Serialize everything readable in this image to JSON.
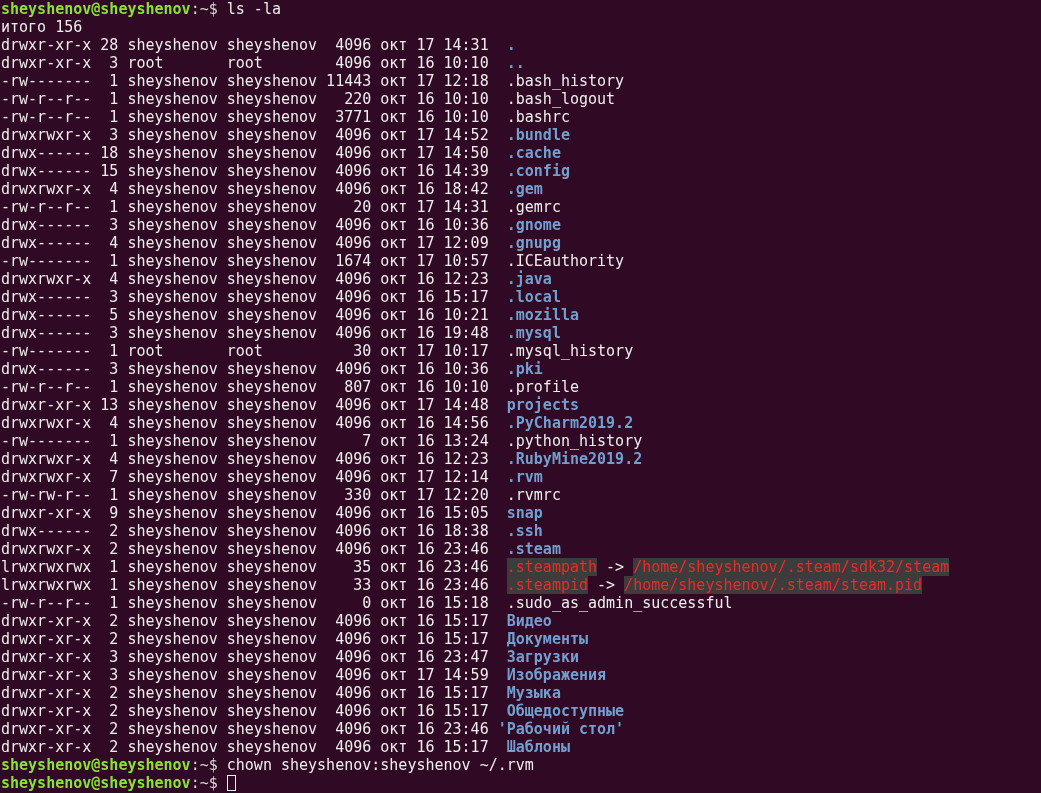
{
  "prompts": [
    {
      "user": "sheyshenov@sheyshenov",
      "path": ":~$",
      "command": "ls -la"
    },
    {
      "user": "sheyshenov@sheyshenov",
      "path": ":~$",
      "command": "chown sheyshenov:sheyshenov ~/.rvm"
    },
    {
      "user": "sheyshenov@sheyshenov",
      "path": ":~$",
      "cursor": true
    }
  ],
  "total": "итого 156",
  "entries": [
    {
      "meta": "drwxr-xr-x 28 sheyshenov sheyshenov  4096 окт 17 14:31  ",
      "name": ".",
      "kind": "dir"
    },
    {
      "meta": "drwxr-xr-x  3 root       root        4096 окт 16 10:10  ",
      "name": "..",
      "kind": "dir"
    },
    {
      "meta": "-rw-------  1 sheyshenov sheyshenov 11443 окт 17 12:18  ",
      "name": ".bash_history",
      "kind": "file"
    },
    {
      "meta": "-rw-r--r--  1 sheyshenov sheyshenov   220 окт 16 10:10  ",
      "name": ".bash_logout",
      "kind": "file"
    },
    {
      "meta": "-rw-r--r--  1 sheyshenov sheyshenov  3771 окт 16 10:10  ",
      "name": ".bashrc",
      "kind": "file"
    },
    {
      "meta": "drwxrwxr-x  3 sheyshenov sheyshenov  4096 окт 17 14:52  ",
      "name": ".bundle",
      "kind": "dir"
    },
    {
      "meta": "drwx------ 18 sheyshenov sheyshenov  4096 окт 17 14:50  ",
      "name": ".cache",
      "kind": "dir"
    },
    {
      "meta": "drwx------ 15 sheyshenov sheyshenov  4096 окт 16 14:39  ",
      "name": ".config",
      "kind": "dir"
    },
    {
      "meta": "drwxrwxr-x  4 sheyshenov sheyshenov  4096 окт 16 18:42  ",
      "name": ".gem",
      "kind": "dir"
    },
    {
      "meta": "-rw-r--r--  1 sheyshenov sheyshenov    20 окт 17 14:31  ",
      "name": ".gemrc",
      "kind": "file"
    },
    {
      "meta": "drwx------  3 sheyshenov sheyshenov  4096 окт 16 10:36  ",
      "name": ".gnome",
      "kind": "dir"
    },
    {
      "meta": "drwx------  4 sheyshenov sheyshenov  4096 окт 17 12:09  ",
      "name": ".gnupg",
      "kind": "dir"
    },
    {
      "meta": "-rw-------  1 sheyshenov sheyshenov  1674 окт 17 10:57  ",
      "name": ".ICEauthority",
      "kind": "file"
    },
    {
      "meta": "drwxrwxr-x  4 sheyshenov sheyshenov  4096 окт 16 12:23  ",
      "name": ".java",
      "kind": "dir"
    },
    {
      "meta": "drwx------  3 sheyshenov sheyshenov  4096 окт 16 15:17  ",
      "name": ".local",
      "kind": "dir"
    },
    {
      "meta": "drwx------  5 sheyshenov sheyshenov  4096 окт 16 10:21  ",
      "name": ".mozilla",
      "kind": "dir"
    },
    {
      "meta": "drwx------  3 sheyshenov sheyshenov  4096 окт 16 19:48  ",
      "name": ".mysql",
      "kind": "dir"
    },
    {
      "meta": "-rw-------  1 root       root          30 окт 17 10:17  ",
      "name": ".mysql_history",
      "kind": "file"
    },
    {
      "meta": "drwx------  3 sheyshenov sheyshenov  4096 окт 16 10:36  ",
      "name": ".pki",
      "kind": "dir"
    },
    {
      "meta": "-rw-r--r--  1 sheyshenov sheyshenov   807 окт 16 10:10  ",
      "name": ".profile",
      "kind": "file"
    },
    {
      "meta": "drwxr-xr-x 13 sheyshenov sheyshenov  4096 окт 17 14:48  ",
      "name": "projects",
      "kind": "dir"
    },
    {
      "meta": "drwxrwxr-x  4 sheyshenov sheyshenov  4096 окт 16 14:56  ",
      "name": ".PyCharm2019.2",
      "kind": "dir"
    },
    {
      "meta": "-rw-------  1 sheyshenov sheyshenov     7 окт 16 13:24  ",
      "name": ".python_history",
      "kind": "file"
    },
    {
      "meta": "drwxrwxr-x  4 sheyshenov sheyshenov  4096 окт 16 12:23  ",
      "name": ".RubyMine2019.2",
      "kind": "dir"
    },
    {
      "meta": "drwxrwxr-x  7 sheyshenov sheyshenov  4096 окт 17 12:14  ",
      "name": ".rvm",
      "kind": "dir"
    },
    {
      "meta": "-rw-rw-r--  1 sheyshenov sheyshenov   330 окт 17 12:20  ",
      "name": ".rvmrc",
      "kind": "file"
    },
    {
      "meta": "drwxr-xr-x  9 sheyshenov sheyshenov  4096 окт 16 15:05  ",
      "name": "snap",
      "kind": "dir"
    },
    {
      "meta": "drwx------  2 sheyshenov sheyshenov  4096 окт 16 18:38  ",
      "name": ".ssh",
      "kind": "dir"
    },
    {
      "meta": "drwxrwxr-x  2 sheyshenov sheyshenov  4096 окт 16 23:46  ",
      "name": ".steam",
      "kind": "dir"
    },
    {
      "meta": "lrwxrwxrwx  1 sheyshenov sheyshenov    35 окт 16 23:46  ",
      "name": ".steampath",
      "kind": "link",
      "arrow": "->",
      "target": "/home/sheyshenov/.steam/sdk32/steam"
    },
    {
      "meta": "lrwxrwxrwx  1 sheyshenov sheyshenov    33 окт 16 23:46  ",
      "name": ".steampid",
      "kind": "link",
      "arrow": "->",
      "target": "/home/sheyshenov/.steam/steam.pid"
    },
    {
      "meta": "-rw-r--r--  1 sheyshenov sheyshenov     0 окт 16 15:18  ",
      "name": ".sudo_as_admin_successful",
      "kind": "file"
    },
    {
      "meta": "drwxr-xr-x  2 sheyshenov sheyshenov  4096 окт 16 15:17  ",
      "name": "Видео",
      "kind": "dir"
    },
    {
      "meta": "drwxr-xr-x  2 sheyshenov sheyshenov  4096 окт 16 15:17  ",
      "name": "Документы",
      "kind": "dir"
    },
    {
      "meta": "drwxr-xr-x  3 sheyshenov sheyshenov  4096 окт 16 23:47  ",
      "name": "Загрузки",
      "kind": "dir"
    },
    {
      "meta": "drwxr-xr-x  3 sheyshenov sheyshenov  4096 окт 17 14:59  ",
      "name": "Изображения",
      "kind": "dir"
    },
    {
      "meta": "drwxr-xr-x  2 sheyshenov sheyshenov  4096 окт 16 15:17  ",
      "name": "Музыка",
      "kind": "dir"
    },
    {
      "meta": "drwxr-xr-x  2 sheyshenov sheyshenov  4096 окт 16 15:17  ",
      "name": "Общедоступные",
      "kind": "dir"
    },
    {
      "meta": "drwxr-xr-x  2 sheyshenov sheyshenov  4096 окт 16 23:46 ",
      "name": "'Рабочий стол'",
      "kind": "dir"
    },
    {
      "meta": "drwxr-xr-x  2 sheyshenov sheyshenov  4096 окт 16 15:17  ",
      "name": "Шаблоны",
      "kind": "dir"
    }
  ]
}
